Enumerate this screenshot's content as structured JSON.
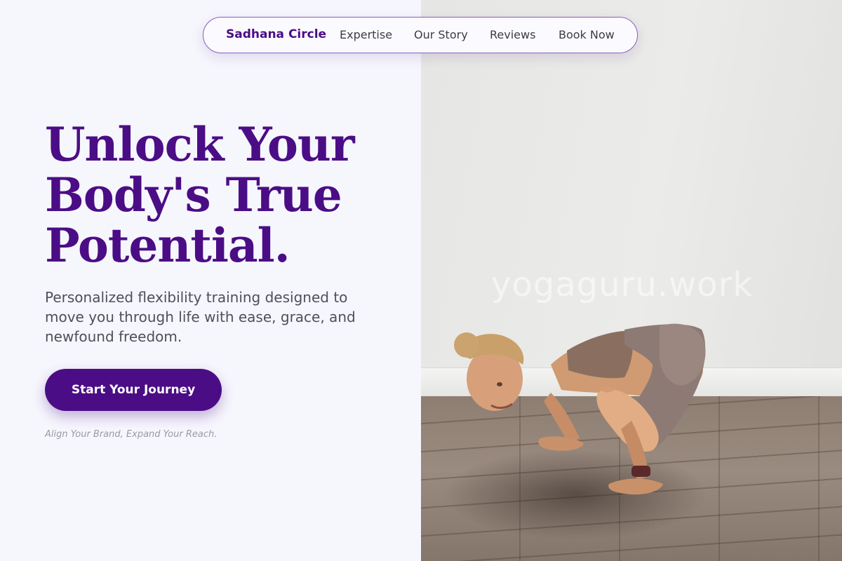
{
  "nav": {
    "brand": "Sadhana Circle",
    "links": [
      "Expertise",
      "Our Story",
      "Reviews",
      "Book Now"
    ]
  },
  "hero": {
    "headline_lines": [
      "Unlock Your",
      "Body's True",
      "Potential."
    ],
    "subtitle_lines": [
      "Personalized flexibility training designed to",
      "move you through life with ease, grace, and",
      "newfound freedom."
    ],
    "cta_label": "Start Your Journey",
    "tagline": "Align Your Brand, Expand Your Reach."
  },
  "photo": {
    "watermark": "yogaguru.work",
    "subject": "woman in arm-balance yoga pose on wooden floor"
  },
  "colors": {
    "accent": "#4b0d85",
    "page_background": "#f6f6fd",
    "body_text": "#4f4f5a",
    "muted_text": "#9a9aa4"
  }
}
